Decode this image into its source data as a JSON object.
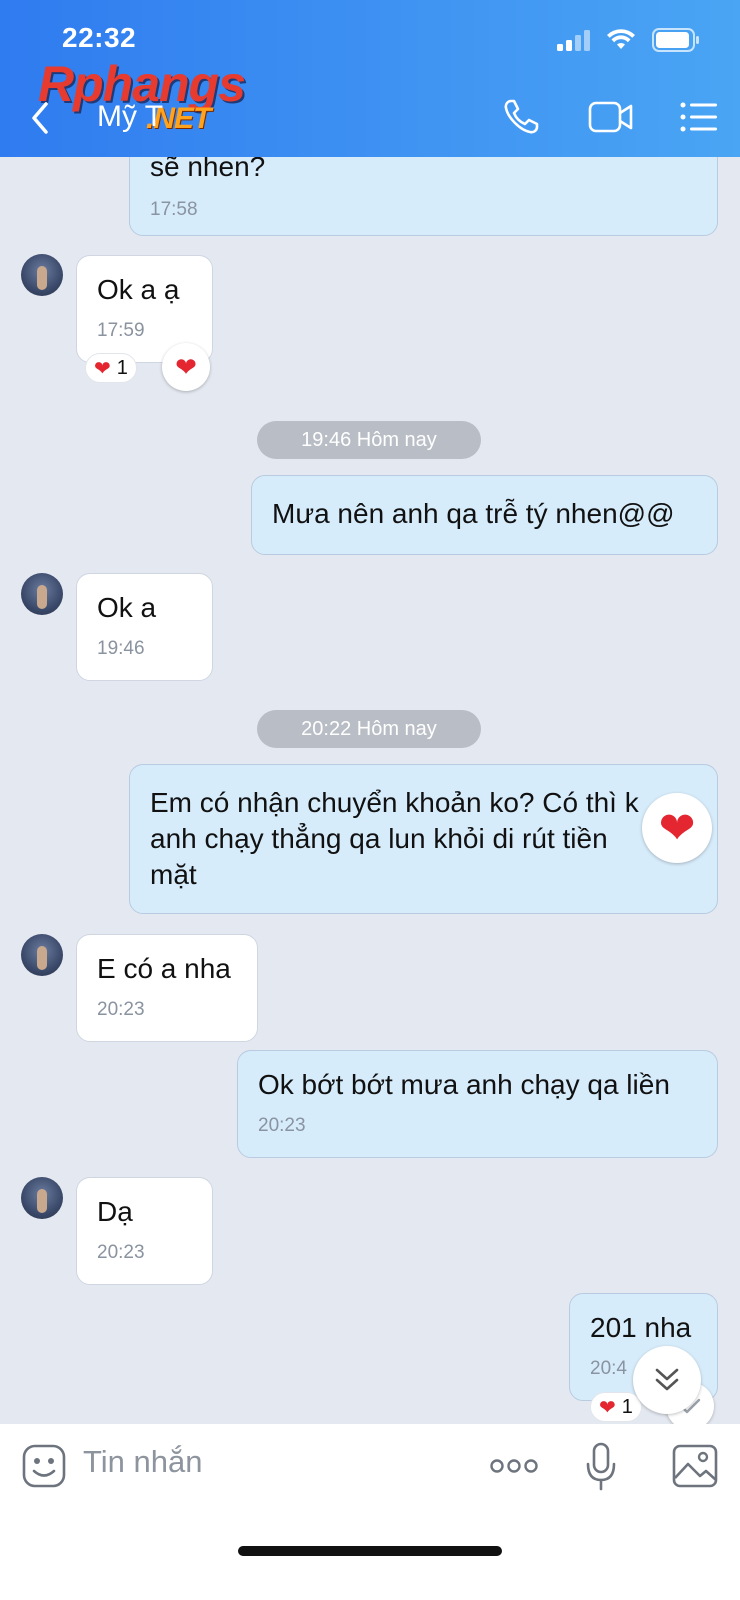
{
  "status_bar": {
    "time": "22:32"
  },
  "header": {
    "contact_name": "Mỹ T",
    "watermark_main": "Rphangs",
    "watermark_net": ".NET"
  },
  "messages": {
    "m0": {
      "text": "sẽ nhen?",
      "time": "17:58"
    },
    "m1": {
      "text": "Ok a ạ",
      "time": "17:59",
      "reaction_count": "1"
    },
    "d1": {
      "label": "19:46 Hôm nay"
    },
    "m2": {
      "text": "Mưa nên anh qa trễ tý nhen@@"
    },
    "m3": {
      "text": "Ok a",
      "time": "19:46"
    },
    "d2": {
      "label": "20:22 Hôm nay"
    },
    "m4": {
      "line1": "Em có nhận chuyển khoản ko? Có thì k",
      "line2": "anh chạy thẳng qa lun khỏi di rút tiền",
      "line3": "mặt"
    },
    "m5": {
      "text": "E có a nha",
      "time": "20:23"
    },
    "m6": {
      "text": "Ok bớt bớt mưa anh chạy qa liền",
      "time": "20:23"
    },
    "m7": {
      "text": "Dạ",
      "time": "20:23"
    },
    "m8": {
      "text": "201 nha",
      "time": "20:4",
      "reaction_count": "1"
    }
  },
  "composer": {
    "placeholder": "Tin nhắn"
  },
  "colors": {
    "header_start": "#2f7bf0",
    "header_end": "#4aa5f4",
    "outgoing_bubble": "#d7ecfb",
    "incoming_bubble": "#ffffff",
    "background": "#e4e8f0",
    "heart": "#e3262f"
  },
  "icons": [
    "back-chevron-icon",
    "phone-icon",
    "video-call-icon",
    "menu-list-icon",
    "sticker-icon",
    "more-icon",
    "microphone-icon",
    "image-icon",
    "heart-icon",
    "scroll-down-icon",
    "check-icon"
  ]
}
